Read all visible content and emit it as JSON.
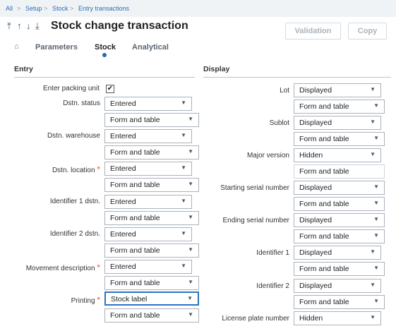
{
  "breadcrumb": {
    "all": "All",
    "setup": "Setup",
    "stock": "Stock",
    "current": "Entry transactions",
    "sep": ">"
  },
  "header": {
    "title": "Stock change transaction",
    "up_icon": "↑",
    "top_icon": "⤒",
    "down_icon": "↓",
    "bottom_icon": "⤓",
    "validation": "Validation",
    "copy": "Copy"
  },
  "tabs": {
    "home_icon": "⌂",
    "parameters": "Parameters",
    "stock": "Stock",
    "analytical": "Analytical",
    "active": "Stock"
  },
  "entry": {
    "title": "Entry",
    "packing_label": "Enter packing unit",
    "packing_checked": "✔",
    "dstn_status": {
      "label": "Dstn. status",
      "value": "Entered",
      "mode": "Form and table"
    },
    "dstn_warehouse": {
      "label": "Dstn. warehouse",
      "value": "Entered",
      "mode": "Form and table"
    },
    "dstn_location": {
      "label": "Dstn. location",
      "value": "Entered",
      "mode": "Form and table"
    },
    "identifier1": {
      "label": "Identifier 1 dstn.",
      "value": "Entered",
      "mode": "Form and table"
    },
    "identifier2": {
      "label": "Identifier 2 dstn.",
      "value": "Entered",
      "mode": "Form and table"
    },
    "movement": {
      "label": "Movement description",
      "value": "Entered",
      "mode": "Form and table"
    },
    "printing": {
      "label": "Printing",
      "value": "Stock label",
      "mode": "Form and table"
    },
    "required_mark": "*"
  },
  "display": {
    "title": "Display",
    "lot": {
      "label": "Lot",
      "value": "Displayed",
      "mode": "Form and table"
    },
    "sublot": {
      "label": "Sublot",
      "value": "Displayed",
      "mode": "Form and table"
    },
    "major_version": {
      "label": "Major version",
      "value": "Hidden",
      "mode": "Form and table"
    },
    "start_serial": {
      "label": "Starting serial number",
      "value": "Displayed",
      "mode": "Form and table"
    },
    "end_serial": {
      "label": "Ending serial number",
      "value": "Displayed",
      "mode": "Form and table"
    },
    "identifier1": {
      "label": "Identifier 1",
      "value": "Displayed",
      "mode": "Form and table"
    },
    "identifier2": {
      "label": "Identifier 2",
      "value": "Displayed",
      "mode": "Form and table"
    },
    "license_plate": {
      "label": "License plate number",
      "value": "Hidden"
    }
  },
  "colors": {
    "accent": "#1f6bb5",
    "required": "#e0562a",
    "section_rule": "#b6c7d7"
  },
  "icons": {
    "caret": "▼"
  }
}
